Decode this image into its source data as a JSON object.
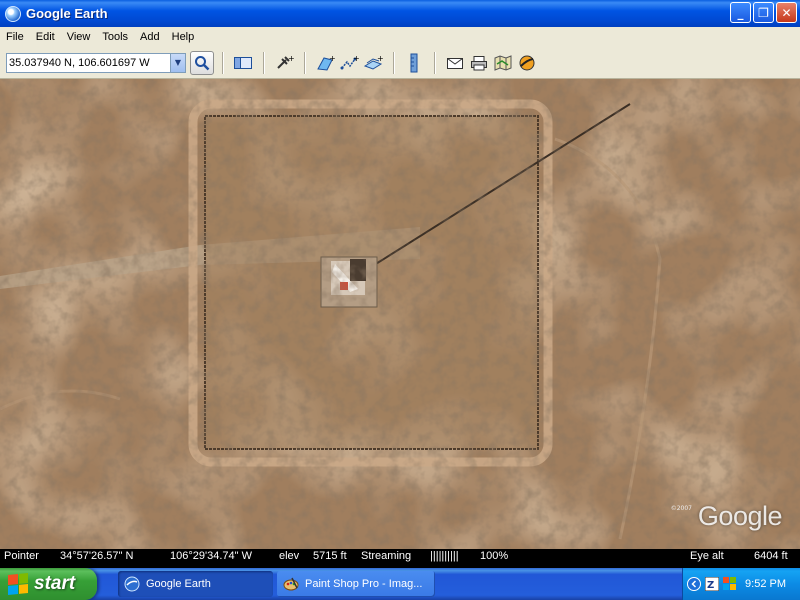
{
  "window": {
    "title": "Google Earth",
    "buttons": {
      "minimize": "_",
      "maximize": "❐",
      "close": "✕"
    }
  },
  "menu": {
    "items": [
      "File",
      "Edit",
      "View",
      "Tools",
      "Add",
      "Help"
    ]
  },
  "toolbar": {
    "search_value": "35.037940 N, 106.601697 W",
    "icons": [
      "search-icon",
      "sidebar-icon",
      "placemark-icon",
      "polygon-icon",
      "path-icon",
      "image-overlay-icon",
      "ruler-icon",
      "email-icon",
      "print-icon",
      "google-maps-icon",
      "sky-icon"
    ]
  },
  "map": {
    "watermark": "Google",
    "watermark_year": "©2007"
  },
  "status": {
    "pointer_label": "Pointer",
    "lat": "34°57'26.57\" N",
    "lon": "106°29'34.74\" W",
    "elev_label": "elev",
    "elev_value": "5715 ft",
    "streaming_label": "Streaming",
    "streaming_bar": "||||||||||",
    "streaming_pct": "100%",
    "eye_alt_label": "Eye alt",
    "eye_alt_value": "6404 ft"
  },
  "taskbar": {
    "start_label": "start",
    "tasks": [
      {
        "label": "Google Earth",
        "active": true
      },
      {
        "label": "Paint Shop Pro - Imag...",
        "active": false
      }
    ],
    "clock": "9:52 PM"
  }
}
